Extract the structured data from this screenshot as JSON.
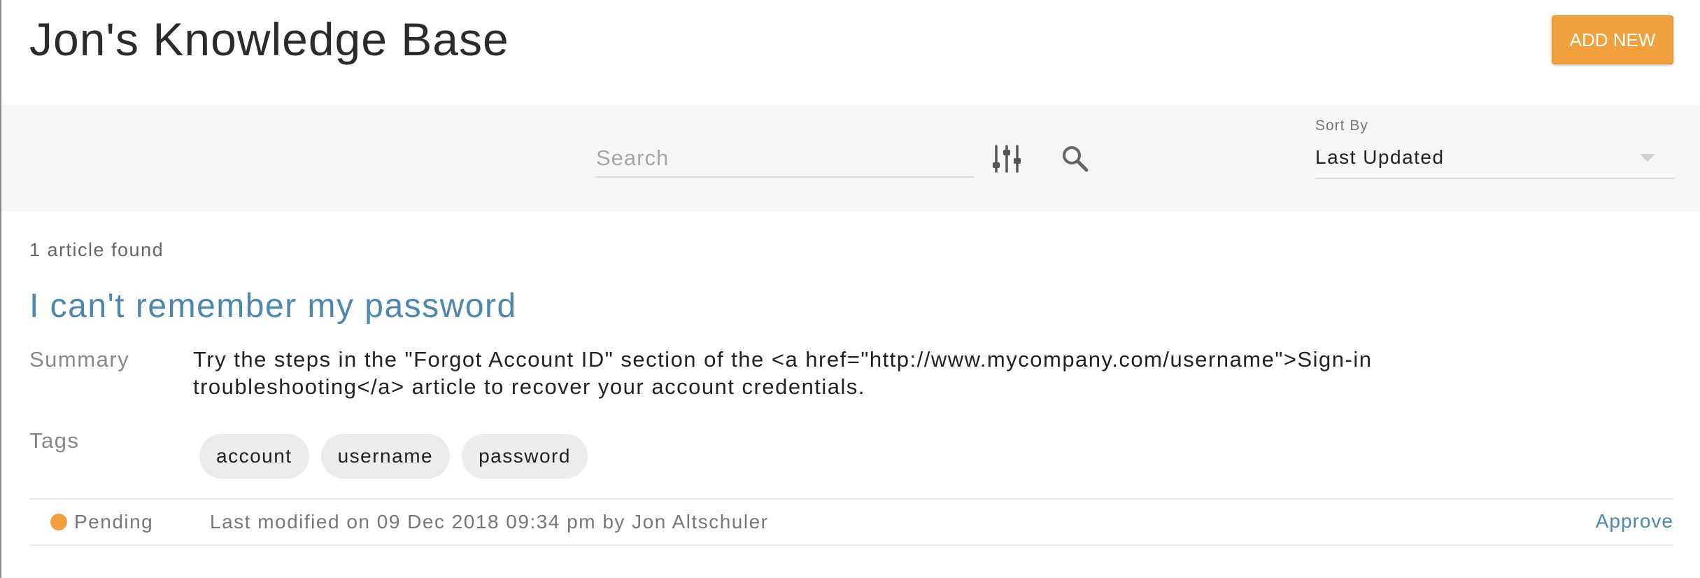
{
  "header": {
    "title": "Jon's Knowledge Base",
    "add_button_label": "ADD NEW"
  },
  "toolbar": {
    "search_placeholder": "Search",
    "search_value": "",
    "filter_icon": "sliders-icon",
    "search_icon": "search-icon",
    "sort_label": "Sort By",
    "sort_value": "Last Updated"
  },
  "results": {
    "count_text": "1 article found",
    "articles": [
      {
        "title": "I can't remember my password",
        "summary_label": "Summary",
        "summary": "Try the steps in the \"Forgot Account ID\" section of the <a href=\"http://www.mycompany.com/username\">Sign-in troubleshooting</a> article to recover your account credentials.",
        "tags_label": "Tags",
        "tags": [
          "account",
          "username",
          "password"
        ],
        "status": "Pending",
        "status_color": "#f0a13d",
        "modified": "Last modified on 09 Dec 2018 09:34 pm by Jon Altschuler",
        "action_label": "Approve"
      }
    ]
  },
  "colors": {
    "accent": "#f0a13d",
    "link": "#4e87ae",
    "toolbar_bg": "#f6f6f6"
  }
}
